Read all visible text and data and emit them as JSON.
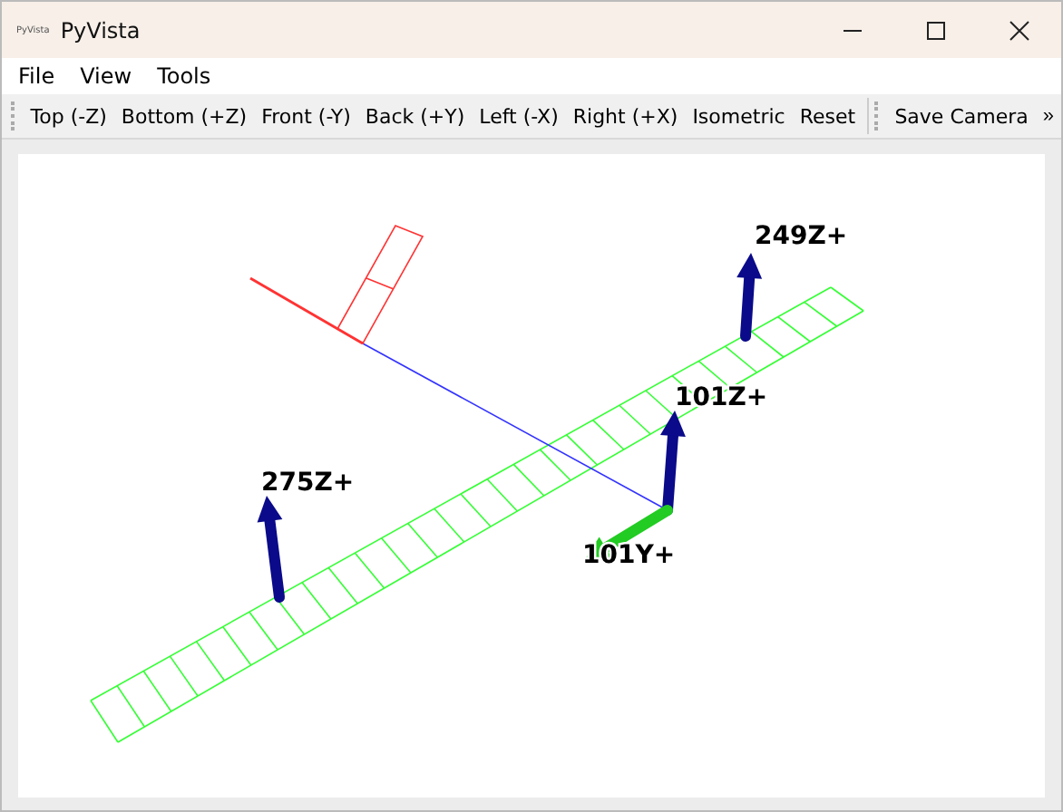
{
  "window": {
    "title": "PyVista",
    "logo": "PyVista"
  },
  "menu": [
    "File",
    "View",
    "Tools"
  ],
  "toolbar": {
    "groups": [
      [
        "Top (-Z)",
        "Bottom (+Z)",
        "Front (-Y)",
        "Back (+Y)",
        "Left (-X)",
        "Right (+X)",
        "Isometric",
        "Reset"
      ],
      [
        "Save Camera"
      ]
    ],
    "overflow": "»"
  },
  "scene": {
    "labels": [
      {
        "text": "249Z+",
        "kind": "z"
      },
      {
        "text": "101Z+",
        "kind": "z"
      },
      {
        "text": "275Z+",
        "kind": "z"
      },
      {
        "text": "101Y+",
        "kind": "y"
      }
    ]
  }
}
